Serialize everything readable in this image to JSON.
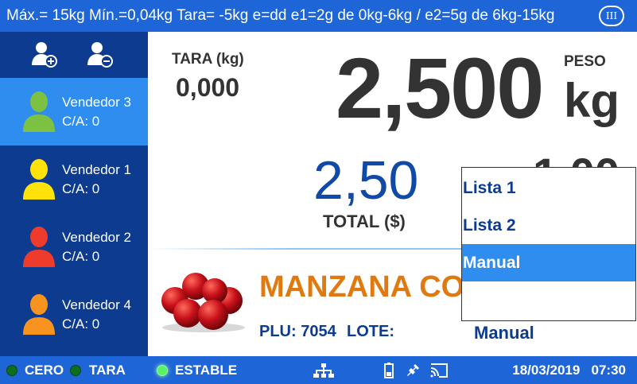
{
  "topbar": {
    "spec": "Máx.= 15kg  Mín.=0,04kg  Tara= -5kg  e=dd  e1=2g de 0kg-6kg / e2=5g de 6kg-15kg",
    "class_badge": "III"
  },
  "sidebar": {
    "add_icon": "add-user-icon",
    "remove_icon": "remove-user-icon",
    "sellers": [
      {
        "name": "Vendedor 3",
        "count": "C/A: 0",
        "color": "#7cc142",
        "active": true
      },
      {
        "name": "Vendedor 1",
        "count": "C/A: 0",
        "color": "#ffe20a",
        "active": false
      },
      {
        "name": "Vendedor 2",
        "count": "C/A: 0",
        "color": "#ef3b2c",
        "active": false
      },
      {
        "name": "Vendedor 4",
        "count": "C/A: 0",
        "color": "#f7931e",
        "active": false
      }
    ]
  },
  "main": {
    "tara_label": "TARA (kg)",
    "tara_value": "0,000",
    "weight_value": "2,500",
    "weight_label": "PESO",
    "weight_unit": "kg",
    "total_value": "2,50",
    "total_label": "TOTAL ($)",
    "unit_price_value": "1,00",
    "product_name": "MANZANA COMUN",
    "plu": "PLU: 7054",
    "lote": "LOTE:",
    "price_mode": "Manual"
  },
  "dropdown": {
    "items": [
      "Lista 1",
      "Lista 2",
      "Manual"
    ],
    "selected": "Manual"
  },
  "statusbar": {
    "cero": "CERO",
    "tara": "TARA",
    "estable": "ESTABLE",
    "date": "18/03/2019",
    "time": "07:30"
  },
  "colors": {
    "topbar": "#1e66d8",
    "sidebar": "#0c3b8f",
    "active_seller": "#2f8df0",
    "product_name": "#e07a10",
    "total": "#0f4aa8"
  }
}
